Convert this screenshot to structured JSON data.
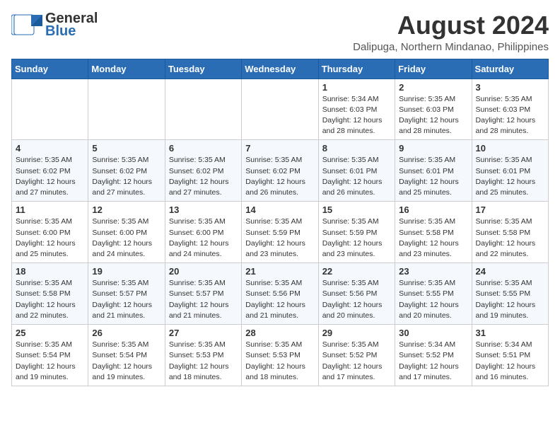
{
  "header": {
    "logo_general": "General",
    "logo_blue": "Blue",
    "month_year": "August 2024",
    "location": "Dalipuga, Northern Mindanao, Philippines"
  },
  "weekdays": [
    "Sunday",
    "Monday",
    "Tuesday",
    "Wednesday",
    "Thursday",
    "Friday",
    "Saturday"
  ],
  "weeks": [
    [
      {
        "day": "",
        "info": ""
      },
      {
        "day": "",
        "info": ""
      },
      {
        "day": "",
        "info": ""
      },
      {
        "day": "",
        "info": ""
      },
      {
        "day": "1",
        "info": "Sunrise: 5:34 AM\nSunset: 6:03 PM\nDaylight: 12 hours\nand 28 minutes."
      },
      {
        "day": "2",
        "info": "Sunrise: 5:35 AM\nSunset: 6:03 PM\nDaylight: 12 hours\nand 28 minutes."
      },
      {
        "day": "3",
        "info": "Sunrise: 5:35 AM\nSunset: 6:03 PM\nDaylight: 12 hours\nand 28 minutes."
      }
    ],
    [
      {
        "day": "4",
        "info": "Sunrise: 5:35 AM\nSunset: 6:02 PM\nDaylight: 12 hours\nand 27 minutes."
      },
      {
        "day": "5",
        "info": "Sunrise: 5:35 AM\nSunset: 6:02 PM\nDaylight: 12 hours\nand 27 minutes."
      },
      {
        "day": "6",
        "info": "Sunrise: 5:35 AM\nSunset: 6:02 PM\nDaylight: 12 hours\nand 27 minutes."
      },
      {
        "day": "7",
        "info": "Sunrise: 5:35 AM\nSunset: 6:02 PM\nDaylight: 12 hours\nand 26 minutes."
      },
      {
        "day": "8",
        "info": "Sunrise: 5:35 AM\nSunset: 6:01 PM\nDaylight: 12 hours\nand 26 minutes."
      },
      {
        "day": "9",
        "info": "Sunrise: 5:35 AM\nSunset: 6:01 PM\nDaylight: 12 hours\nand 25 minutes."
      },
      {
        "day": "10",
        "info": "Sunrise: 5:35 AM\nSunset: 6:01 PM\nDaylight: 12 hours\nand 25 minutes."
      }
    ],
    [
      {
        "day": "11",
        "info": "Sunrise: 5:35 AM\nSunset: 6:00 PM\nDaylight: 12 hours\nand 25 minutes."
      },
      {
        "day": "12",
        "info": "Sunrise: 5:35 AM\nSunset: 6:00 PM\nDaylight: 12 hours\nand 24 minutes."
      },
      {
        "day": "13",
        "info": "Sunrise: 5:35 AM\nSunset: 6:00 PM\nDaylight: 12 hours\nand 24 minutes."
      },
      {
        "day": "14",
        "info": "Sunrise: 5:35 AM\nSunset: 5:59 PM\nDaylight: 12 hours\nand 23 minutes."
      },
      {
        "day": "15",
        "info": "Sunrise: 5:35 AM\nSunset: 5:59 PM\nDaylight: 12 hours\nand 23 minutes."
      },
      {
        "day": "16",
        "info": "Sunrise: 5:35 AM\nSunset: 5:58 PM\nDaylight: 12 hours\nand 23 minutes."
      },
      {
        "day": "17",
        "info": "Sunrise: 5:35 AM\nSunset: 5:58 PM\nDaylight: 12 hours\nand 22 minutes."
      }
    ],
    [
      {
        "day": "18",
        "info": "Sunrise: 5:35 AM\nSunset: 5:58 PM\nDaylight: 12 hours\nand 22 minutes."
      },
      {
        "day": "19",
        "info": "Sunrise: 5:35 AM\nSunset: 5:57 PM\nDaylight: 12 hours\nand 21 minutes."
      },
      {
        "day": "20",
        "info": "Sunrise: 5:35 AM\nSunset: 5:57 PM\nDaylight: 12 hours\nand 21 minutes."
      },
      {
        "day": "21",
        "info": "Sunrise: 5:35 AM\nSunset: 5:56 PM\nDaylight: 12 hours\nand 21 minutes."
      },
      {
        "day": "22",
        "info": "Sunrise: 5:35 AM\nSunset: 5:56 PM\nDaylight: 12 hours\nand 20 minutes."
      },
      {
        "day": "23",
        "info": "Sunrise: 5:35 AM\nSunset: 5:55 PM\nDaylight: 12 hours\nand 20 minutes."
      },
      {
        "day": "24",
        "info": "Sunrise: 5:35 AM\nSunset: 5:55 PM\nDaylight: 12 hours\nand 19 minutes."
      }
    ],
    [
      {
        "day": "25",
        "info": "Sunrise: 5:35 AM\nSunset: 5:54 PM\nDaylight: 12 hours\nand 19 minutes."
      },
      {
        "day": "26",
        "info": "Sunrise: 5:35 AM\nSunset: 5:54 PM\nDaylight: 12 hours\nand 19 minutes."
      },
      {
        "day": "27",
        "info": "Sunrise: 5:35 AM\nSunset: 5:53 PM\nDaylight: 12 hours\nand 18 minutes."
      },
      {
        "day": "28",
        "info": "Sunrise: 5:35 AM\nSunset: 5:53 PM\nDaylight: 12 hours\nand 18 minutes."
      },
      {
        "day": "29",
        "info": "Sunrise: 5:35 AM\nSunset: 5:52 PM\nDaylight: 12 hours\nand 17 minutes."
      },
      {
        "day": "30",
        "info": "Sunrise: 5:34 AM\nSunset: 5:52 PM\nDaylight: 12 hours\nand 17 minutes."
      },
      {
        "day": "31",
        "info": "Sunrise: 5:34 AM\nSunset: 5:51 PM\nDaylight: 12 hours\nand 16 minutes."
      }
    ]
  ]
}
